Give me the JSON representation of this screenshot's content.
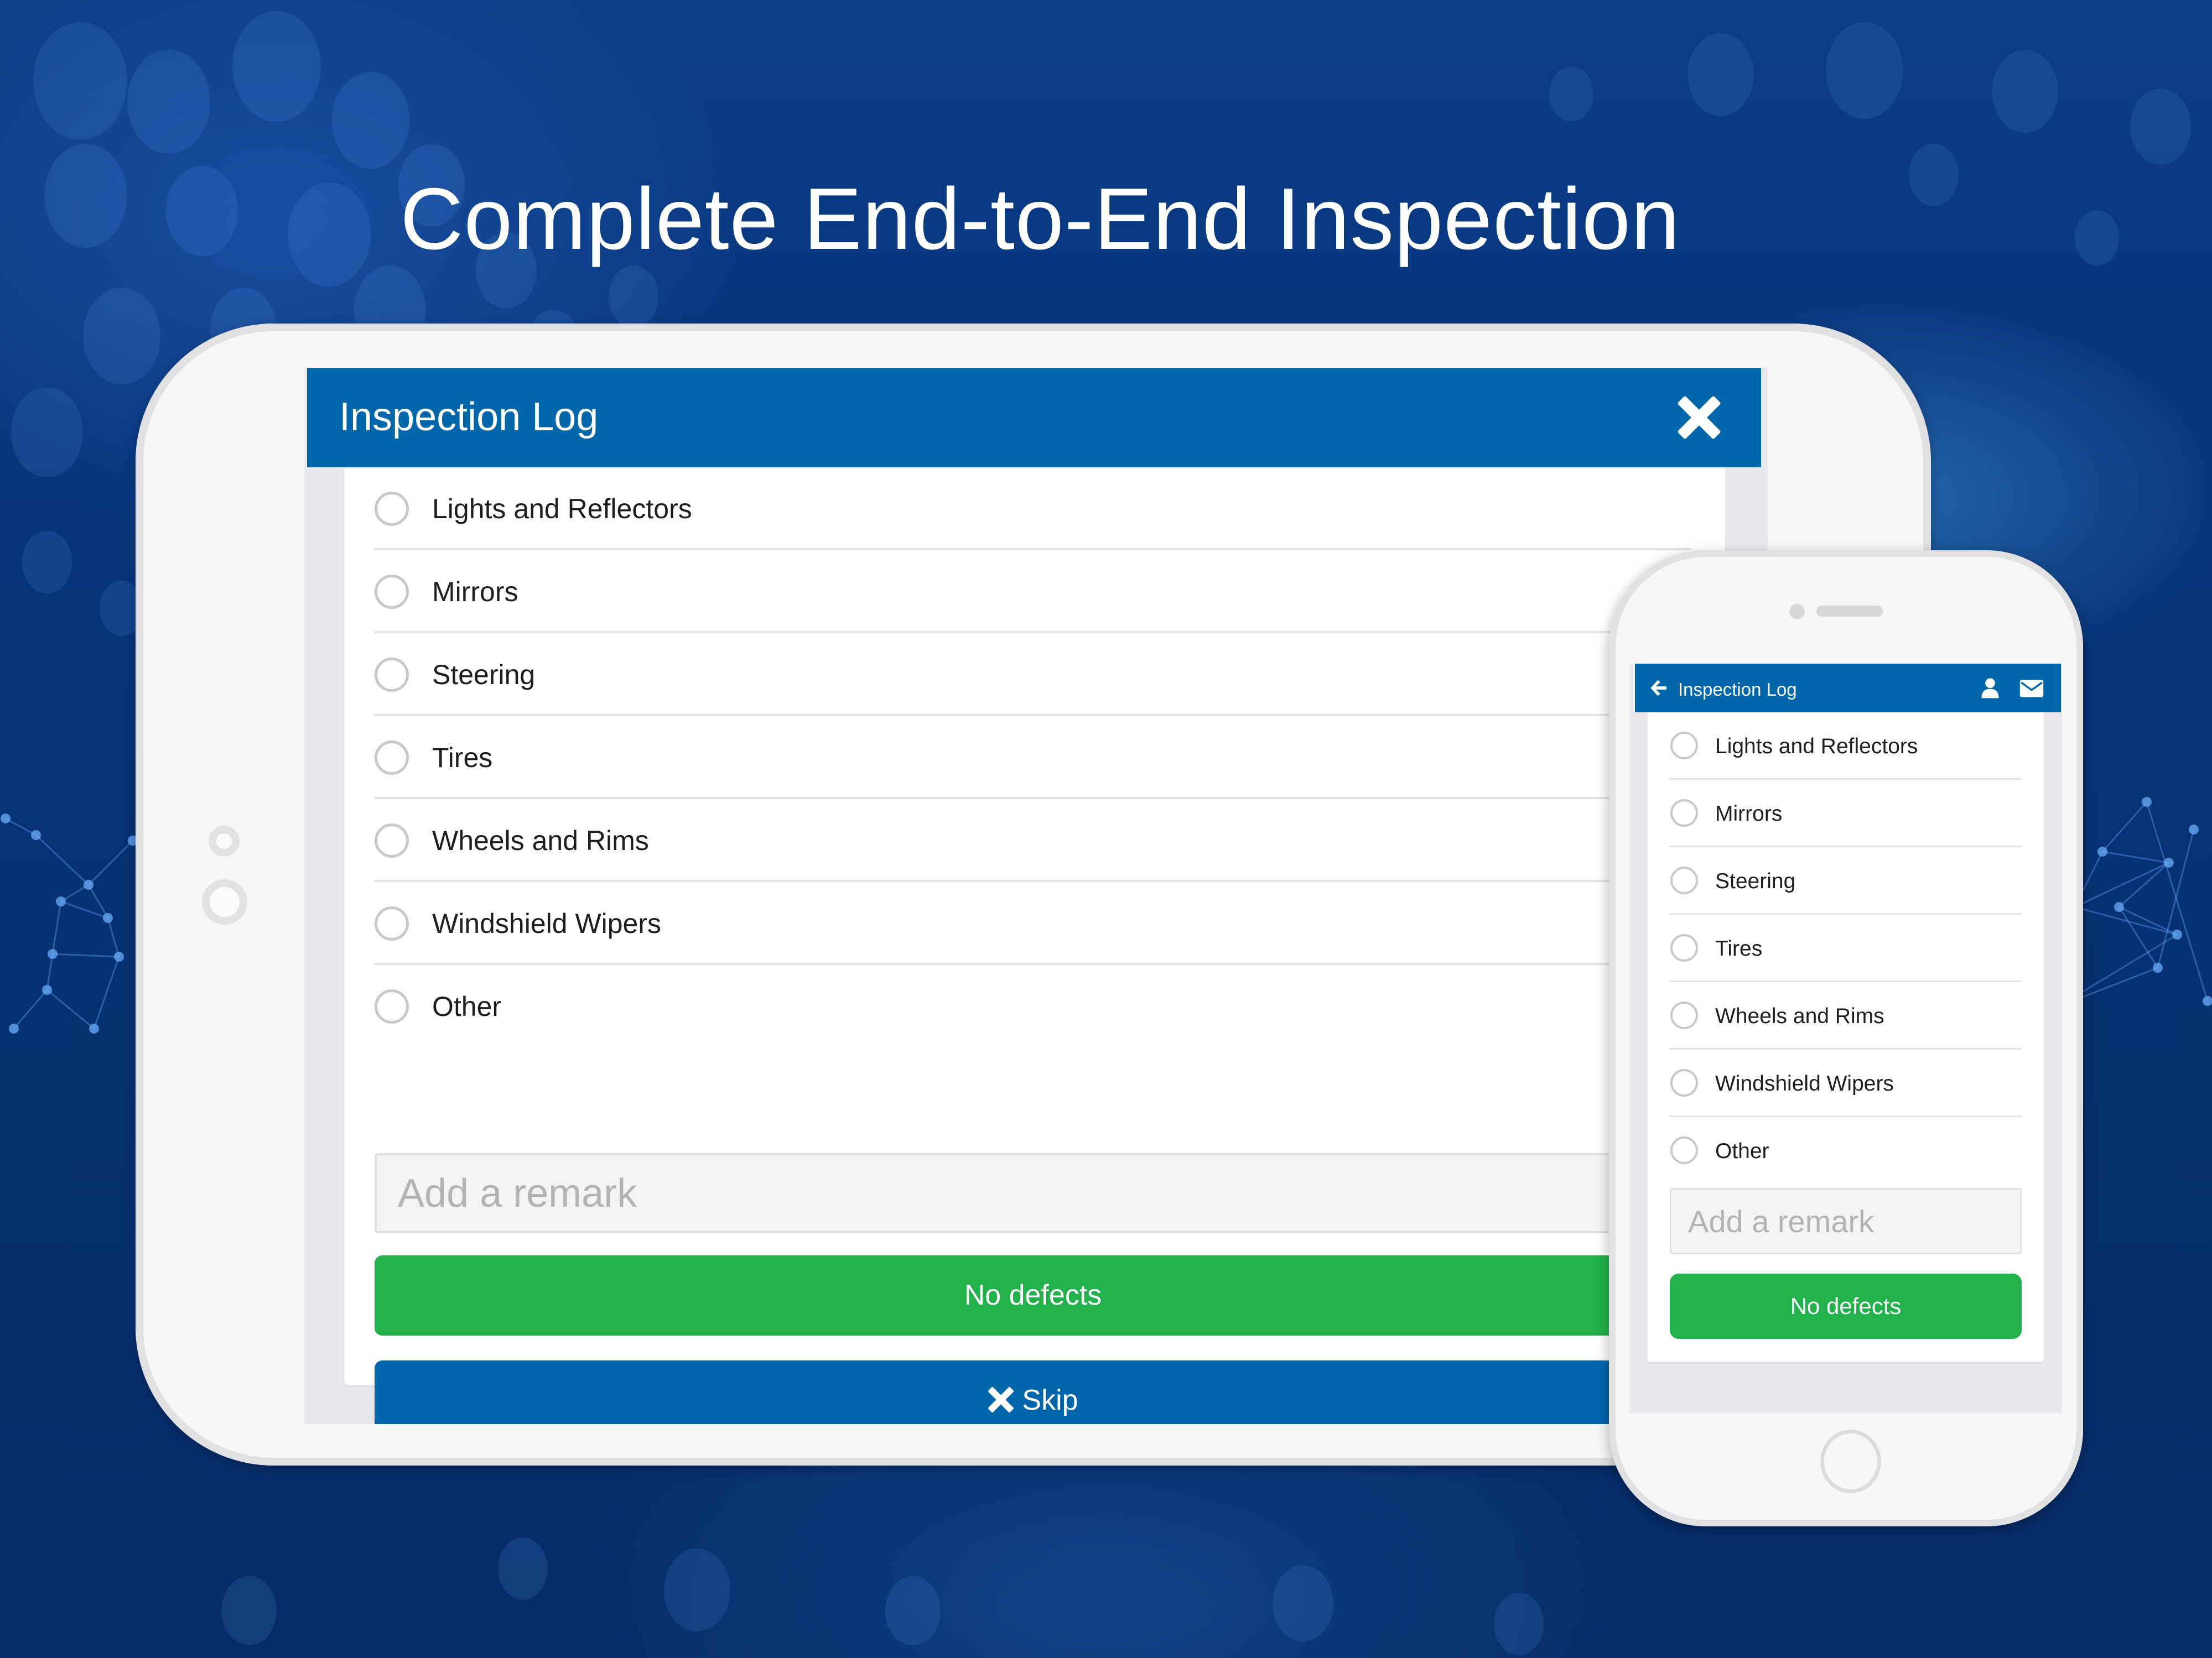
{
  "headline": "Complete End-to-End Inspection",
  "colors": {
    "primary": "#0066AA",
    "success": "#22B14C",
    "background": "#073275"
  },
  "tablet": {
    "header": {
      "title": "Inspection Log",
      "close_icon": "close-icon"
    },
    "checklist": [
      {
        "label": "Lights and Reflectors",
        "checked": false
      },
      {
        "label": "Mirrors",
        "checked": false
      },
      {
        "label": "Steering",
        "checked": false
      },
      {
        "label": "Tires",
        "checked": false
      },
      {
        "label": "Wheels and Rims",
        "checked": false
      },
      {
        "label": "Windshield Wipers",
        "checked": false
      },
      {
        "label": "Other",
        "checked": false
      }
    ],
    "remark": {
      "placeholder": "Add a remark",
      "value": ""
    },
    "no_defects_label": "No defects",
    "skip_label": "Skip",
    "skip_icon": "close-icon"
  },
  "phone": {
    "header": {
      "title": "Inspection Log",
      "back_icon": "arrow-left-icon",
      "user_icon": "user-icon",
      "mail_icon": "envelope-icon"
    },
    "checklist": [
      {
        "label": "Lights and Reflectors",
        "checked": false
      },
      {
        "label": "Mirrors",
        "checked": false
      },
      {
        "label": "Steering",
        "checked": false
      },
      {
        "label": "Tires",
        "checked": false
      },
      {
        "label": "Wheels and Rims",
        "checked": false
      },
      {
        "label": "Windshield Wipers",
        "checked": false
      },
      {
        "label": "Other",
        "checked": false
      }
    ],
    "remark": {
      "placeholder": "Add a remark",
      "value": ""
    },
    "no_defects_label": "No defects"
  }
}
